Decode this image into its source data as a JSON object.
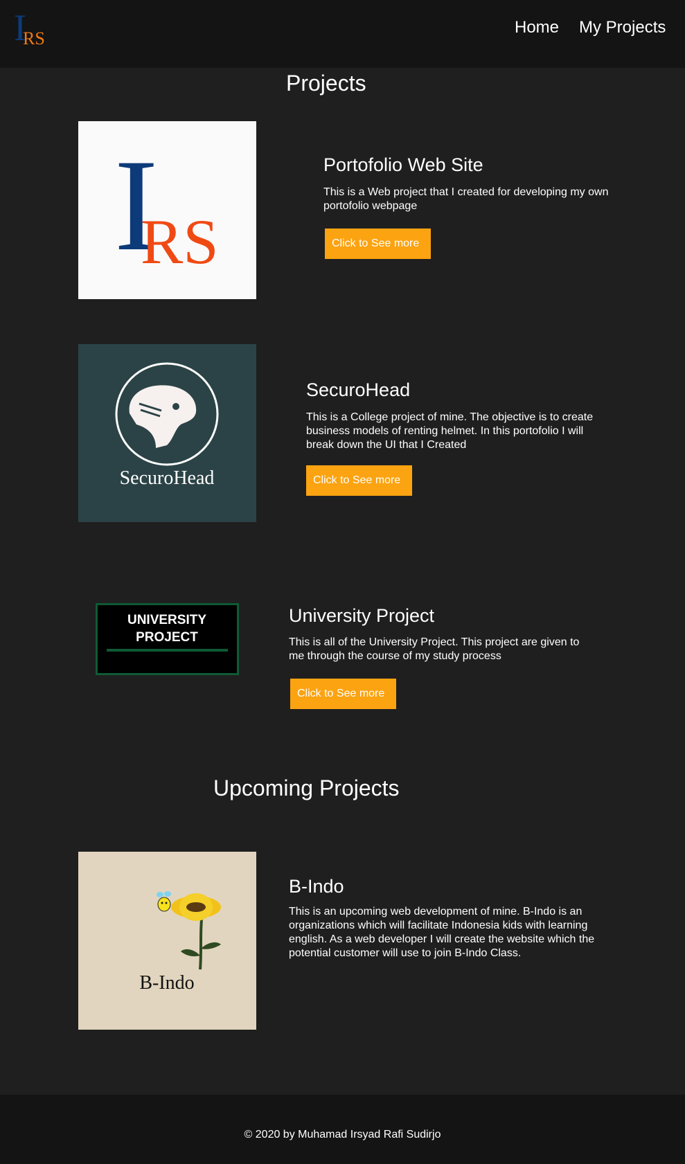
{
  "brand": {
    "logo_letters": {
      "top": "I",
      "bottom": "RS"
    }
  },
  "nav": {
    "home": "Home",
    "projects": "My Projects"
  },
  "headings": {
    "projects": "Projects",
    "upcoming": "Upcoming Projects"
  },
  "projects": [
    {
      "title": "Portofolio Web Site",
      "description": "This is a Web project that I created for developing my own portofolio webpage",
      "button": "Click to See more",
      "image_letters": {
        "top": "I",
        "bottom": "RS"
      }
    },
    {
      "title": "SecuroHead",
      "description": "This is a College project of mine. The objective is to create business models of renting helmet. In this portofolio I will break down the UI that I Created",
      "button": "Click to See more",
      "image_caption": "SecuroHead"
    },
    {
      "title": "University Project",
      "description": "This is all of the University Project. This project are given to me through the course of my study process",
      "button": "Click to See more",
      "image_lines": [
        "UNIVERSITY",
        "PROJECT"
      ]
    }
  ],
  "upcoming": [
    {
      "title": "B-Indo",
      "description": "This is an upcoming web development of mine. B-Indo is an organizations which will facilitate Indonesia kids with learning english. As a web developer I will create the website which the potential customer will use to join B-Indo Class.",
      "image_caption": "B-Indo"
    }
  ],
  "footer": {
    "text": "© 2020 by Muhamad Irsyad Rafi Sudirjo"
  },
  "colors": {
    "page_bg": "#1f1f1f",
    "navbar_bg": "#141414",
    "button": "#fca311",
    "logo_blue": "#0d3b7a",
    "logo_orange": "#f04a14",
    "securohead_bg": "#2b4346",
    "bindo_bg": "#e1d5bf"
  }
}
